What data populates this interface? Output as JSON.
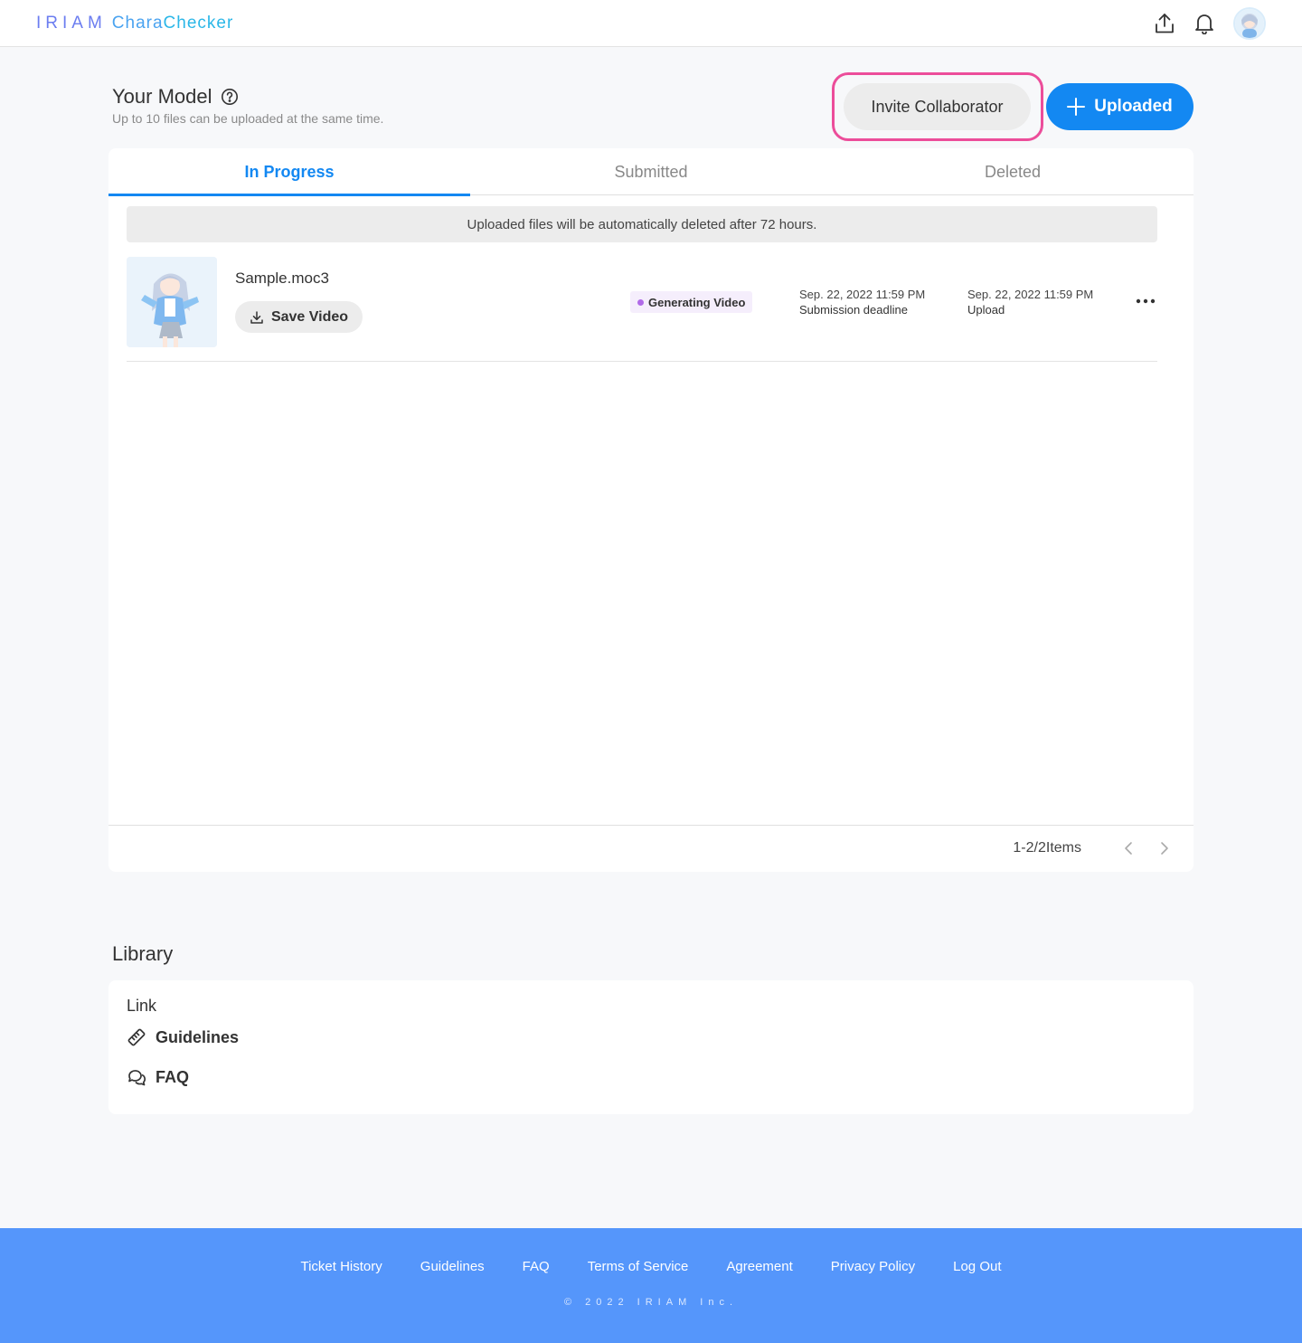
{
  "header": {
    "logo_part1": "IRIAM",
    "logo_part2": "Chara",
    "logo_part3": "Checker"
  },
  "model_section": {
    "title": "Your Model",
    "subtitle": "Up to 10 files can be uploaded at the same time.",
    "invite_label": "Invite Collaborator",
    "upload_label": "Uploaded"
  },
  "tabs": [
    {
      "label": "In Progress",
      "active": true
    },
    {
      "label": "Submitted",
      "active": false
    },
    {
      "label": "Deleted",
      "active": false
    }
  ],
  "notice": "Uploaded files will be automatically deleted after 72 hours.",
  "items": [
    {
      "file_name": "Sample.moc3",
      "save_label": "Save Video",
      "status": "Generating Video",
      "deadline_date": "Sep. 22, 2022 11:59 PM",
      "deadline_label": "Submission deadline",
      "upload_date": "Sep. 22, 2022 11:59 PM",
      "upload_label": "Upload"
    }
  ],
  "pagination": {
    "text": "1-2/2Items"
  },
  "library": {
    "title": "Library",
    "link_heading": "Link",
    "links": [
      {
        "label": "Guidelines",
        "icon": "ruler-icon"
      },
      {
        "label": "FAQ",
        "icon": "chat-bubbles-icon"
      }
    ]
  },
  "footer": {
    "links": [
      "Ticket History",
      "Guidelines",
      "FAQ",
      "Terms of Service",
      "Agreement",
      "Privacy Policy",
      "Log Out"
    ],
    "copyright": "© 2022 IRIAM Inc."
  },
  "colors": {
    "accent": "#1388f2",
    "highlight": "#ec4d9a",
    "footer": "#5596fb",
    "status_dot": "#b06ae8"
  }
}
